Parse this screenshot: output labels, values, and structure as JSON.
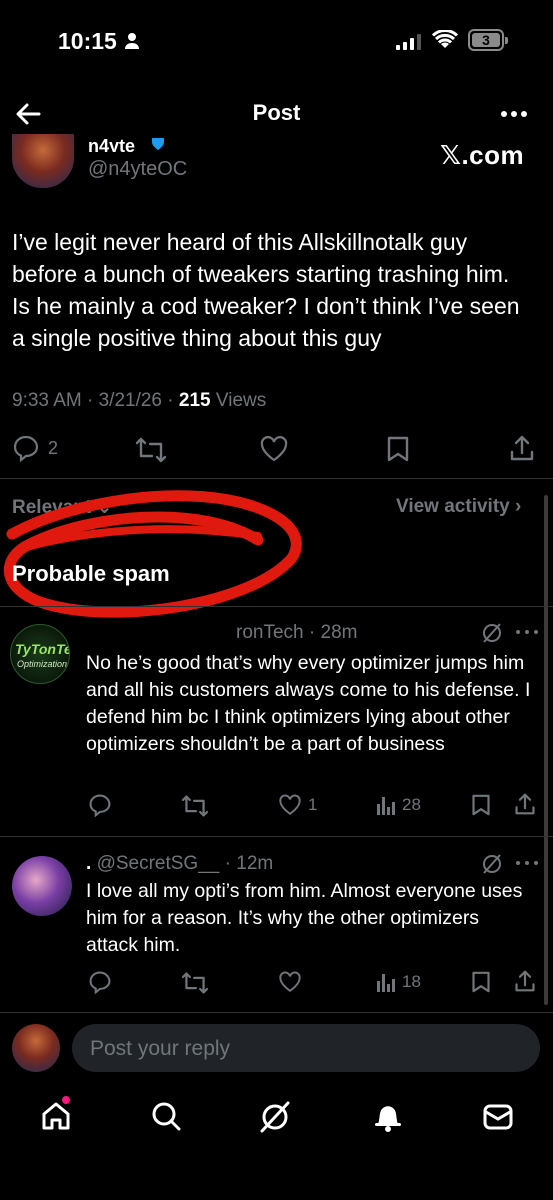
{
  "status_bar": {
    "time": "10:15",
    "battery": "3"
  },
  "header": {
    "title": "Post"
  },
  "post": {
    "name_partial": "n4yte",
    "handle": "@n4yteOC",
    "watermark": "𝕏.com",
    "text": "I’ve legit never heard of this Allskillnotalk guy before a bunch of tweakers starting trashing him. Is he mainly a cod tweaker? I don’t think I’ve seen a single positive thing about this guy",
    "time": "9:33 AM",
    "date": "3/21/26",
    "views_count": "215",
    "views_label": "Views",
    "replies": "2"
  },
  "filters": {
    "relevant": "Relevant ⌄",
    "view_activity": "View activity ›"
  },
  "section": {
    "title": "Probable spam"
  },
  "replies": [
    {
      "avatar_text": "TyTonTech",
      "avatar_sub": "Optimizations",
      "name_fragment": "ronTech",
      "time": "· 28m",
      "text": "No he’s good that’s why every optimizer jumps him and all his customers always come to his defense. I defend him bc I think optimizers lying about other optimizers shouldn’t be a part of business",
      "likes": "1",
      "views": "28"
    },
    {
      "name": ".",
      "handle": "@SecretSG__",
      "time": "· 12m",
      "text": "I love all my opti’s from him. Almost everyone uses him for a reason. It’s why the other optimizers attack him.",
      "likes": "",
      "views": "18"
    }
  ],
  "composer": {
    "placeholder": "Post your reply"
  },
  "icons": [
    "back-arrow-icon",
    "more-icon",
    "verified-icon",
    "reply-icon",
    "repost-icon",
    "like-icon",
    "bookmark-icon",
    "share-icon",
    "grok-icon",
    "views-icon",
    "home-icon",
    "search-icon",
    "bell-icon",
    "mail-icon"
  ],
  "colors": {
    "background": "#000000",
    "text": "#e7e9ea",
    "muted": "#71767b",
    "divider": "#2f3336",
    "scribble": "#e0190e",
    "notification_dot": "#f91880"
  }
}
